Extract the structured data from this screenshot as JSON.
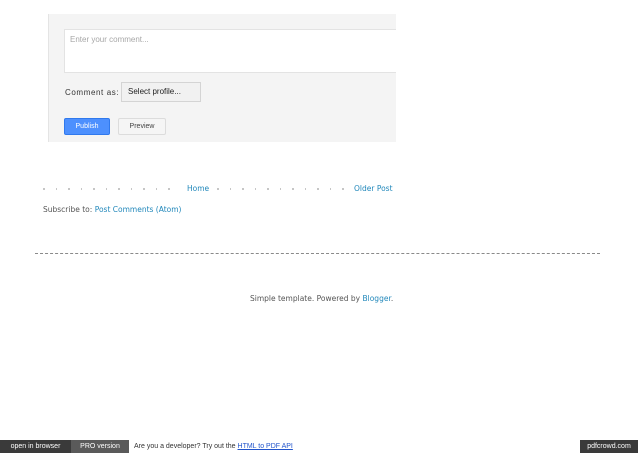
{
  "comment_form": {
    "placeholder": "Enter your comment...",
    "comment_as_label": "Comment as:",
    "profile_select_value": "Select profile...",
    "publish_label": "Publish",
    "preview_label": "Preview"
  },
  "pager": {
    "home_label": "Home",
    "older_label": "Older Post"
  },
  "subscribe": {
    "prefix": "Subscribe to: ",
    "link_label": "Post Comments (Atom)"
  },
  "footer": {
    "attribution_prefix": "Simple template. Powered by ",
    "attribution_link": "Blogger",
    "attribution_suffix": "."
  },
  "pdfcrowd_bar": {
    "open_in_browser": "open in browser",
    "pro_version": "PRO version",
    "developer_text": "Are you a developer? Try out the ",
    "api_link": "HTML to PDF API",
    "brand": "pdfcrowd.com"
  },
  "colors": {
    "link": "#2288bb",
    "publish_button": "#4d90fe",
    "form_background": "#f4f4f4"
  }
}
